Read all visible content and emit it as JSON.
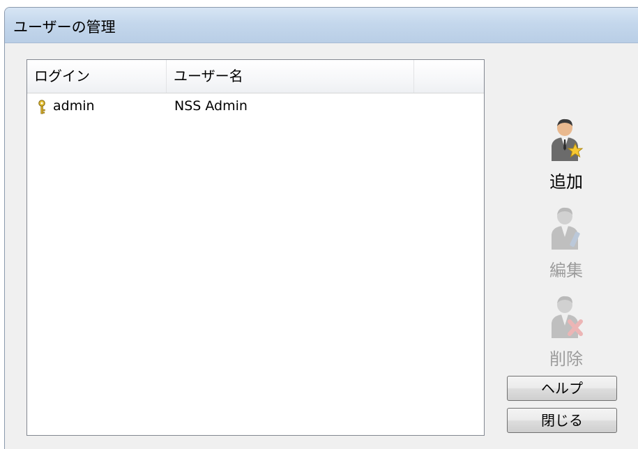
{
  "window": {
    "title": "ユーザーの管理"
  },
  "user_list": {
    "columns": [
      "ログイン",
      "ユーザー名"
    ],
    "rows": [
      {
        "login": "admin",
        "user_name": "NSS Admin",
        "icon": "key-icon"
      }
    ]
  },
  "actions": {
    "add": {
      "label": "追加",
      "icon": "user-add-icon",
      "enabled": true
    },
    "edit": {
      "label": "編集",
      "icon": "user-edit-icon",
      "enabled": false
    },
    "delete": {
      "label": "削除",
      "icon": "user-delete-icon",
      "enabled": false
    }
  },
  "buttons": {
    "help": "ヘルプ",
    "close": "閉じる"
  },
  "colors": {
    "titlebar": "#c4d7ec",
    "window_bg": "#f0f0f0",
    "star": "#f7c832",
    "delete_x": "#e64a4a"
  }
}
